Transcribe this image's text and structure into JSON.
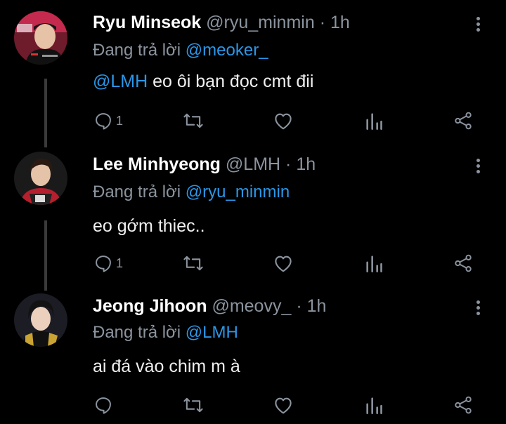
{
  "colors": {
    "background": "#000000",
    "link": "#2a97e8",
    "muted": "#8b949e",
    "thread_line": "#3a3a3a"
  },
  "tweets": [
    {
      "name": "Ryu Minseok",
      "handle": "@ryu_minmin",
      "dot": "·",
      "time": "1h",
      "reply_prefix": "Đang trả lời",
      "reply_to": "@meoker_",
      "mention": "@LMH",
      "text": " eo ôi bạn đọc cmt đii",
      "reply_count": "1"
    },
    {
      "name": "Lee Minhyeong",
      "handle": "@LMH",
      "dot": "·",
      "time": "1h",
      "reply_prefix": "Đang trả lời",
      "reply_to": "@ryu_minmin",
      "mention": "",
      "text": "eo gớm thiec..",
      "reply_count": "1"
    },
    {
      "name": "Jeong Jihoon",
      "handle": "@meovy_",
      "dot": "·",
      "time": "1h",
      "reply_prefix": "Đang trả lời",
      "reply_to": "@LMH",
      "mention": "",
      "text": "ai đá vào chim m à",
      "reply_count": ""
    }
  ],
  "icons": [
    "reply-icon",
    "retweet-icon",
    "like-icon",
    "stats-icon",
    "share-icon",
    "more-options-icon"
  ]
}
